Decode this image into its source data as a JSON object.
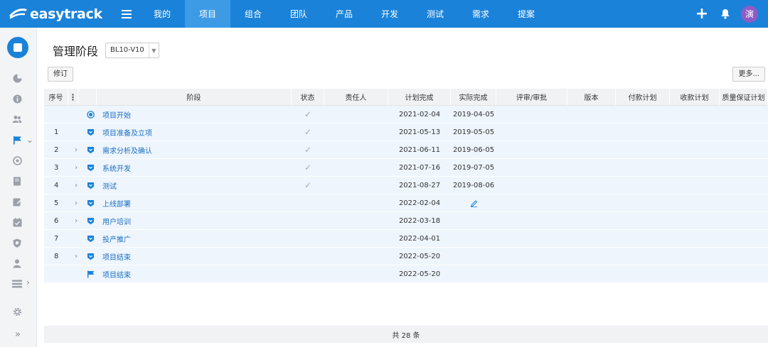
{
  "app": {
    "name": "easytrack"
  },
  "nav": [
    "我的",
    "项目",
    "组合",
    "团队",
    "产品",
    "开发",
    "测试",
    "需求",
    "提案"
  ],
  "user": {
    "avatar_text": "演"
  },
  "page": {
    "title": "管理阶段",
    "version": "BL10-V10",
    "revise_label": "修订",
    "more_label": "更多..."
  },
  "table": {
    "headers": {
      "seq": "序号",
      "stage": "阶段",
      "state": "状态",
      "owner": "责任人",
      "plan": "计划完成",
      "actual": "实际完成",
      "review": "评审/审批",
      "version": "版本",
      "pay": "付款计划",
      "recv": "收款计划",
      "qa": "质量保证计划"
    },
    "rows": [
      {
        "seq": "",
        "expand": "",
        "icon": "start",
        "stage": "项目开始",
        "state": "✓",
        "plan": "2021-02-04",
        "actual": "2019-04-05"
      },
      {
        "seq": "1",
        "expand": "",
        "icon": "shield",
        "stage": "项目准备及立项",
        "state": "✓",
        "plan": "2021-05-13",
        "actual": "2019-05-05"
      },
      {
        "seq": "2",
        "expand": "›",
        "icon": "shield",
        "stage": "需求分析及确认",
        "state": "✓",
        "plan": "2021-06-11",
        "actual": "2019-06-05"
      },
      {
        "seq": "3",
        "expand": "›",
        "icon": "shield",
        "stage": "系统开发",
        "state": "✓",
        "plan": "2021-07-16",
        "actual": "2019-07-05"
      },
      {
        "seq": "4",
        "expand": "›",
        "icon": "shield",
        "stage": "测试",
        "state": "✓",
        "plan": "2021-08-27",
        "actual": "2019-08-06"
      },
      {
        "seq": "5",
        "expand": "›",
        "icon": "shield",
        "stage": "上线部署",
        "state": "",
        "plan": "2022-02-04",
        "actual": "",
        "edit": true
      },
      {
        "seq": "6",
        "expand": "›",
        "icon": "shield",
        "stage": "用户培训",
        "state": "",
        "plan": "2022-03-18",
        "actual": ""
      },
      {
        "seq": "7",
        "expand": "",
        "icon": "shield",
        "stage": "投产推广",
        "state": "",
        "plan": "2022-04-01",
        "actual": ""
      },
      {
        "seq": "8",
        "expand": "›",
        "icon": "shield",
        "stage": "项目结束",
        "state": "",
        "plan": "2022-05-20",
        "actual": ""
      },
      {
        "seq": "",
        "expand": "",
        "icon": "flag",
        "stage": "项目结束",
        "state": "",
        "plan": "2022-05-20",
        "actual": ""
      }
    ]
  },
  "footer": {
    "total": "共 28 条"
  },
  "colors": {
    "primary": "#1a82d9",
    "nav_active": "#3d9be6",
    "row_bg": "#eef5fd",
    "link": "#1a6fc2"
  }
}
